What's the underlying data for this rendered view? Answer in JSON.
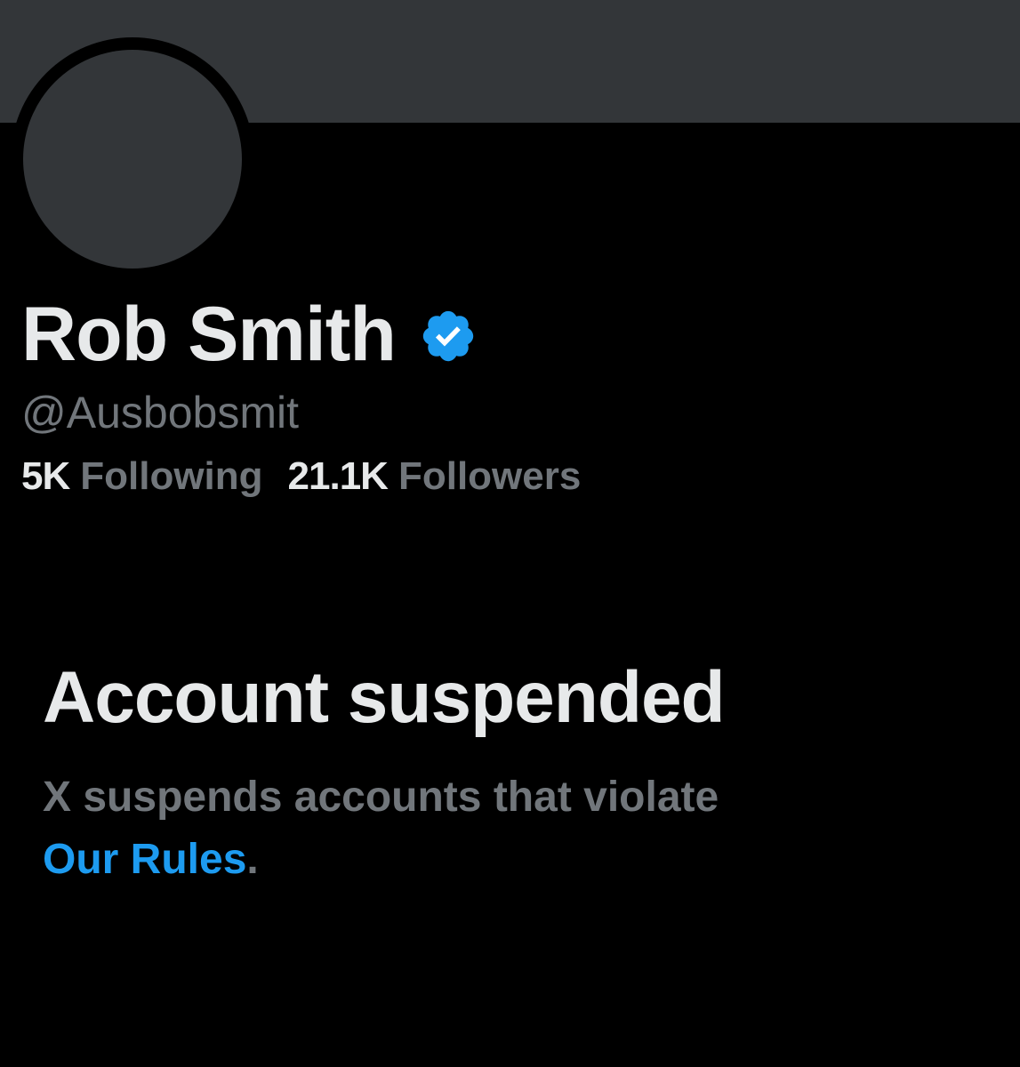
{
  "profile": {
    "display_name": "Rob Smith",
    "handle": "@Ausbobsmit",
    "verified": true,
    "following_count": "5K",
    "following_label": "Following",
    "followers_count": "21.1K",
    "followers_label": "Followers"
  },
  "suspension": {
    "title": "Account suspended",
    "message": "X suspends accounts that violate",
    "link_label": "Our Rules",
    "trailing": "."
  },
  "icons": {
    "verified": "verified-badge-icon"
  },
  "colors": {
    "background": "#000000",
    "banner": "#333639",
    "primary_text": "#e7e9ea",
    "secondary_text": "#71767b",
    "link": "#1d9bf0",
    "verified_badge": "#1d9bf0"
  }
}
